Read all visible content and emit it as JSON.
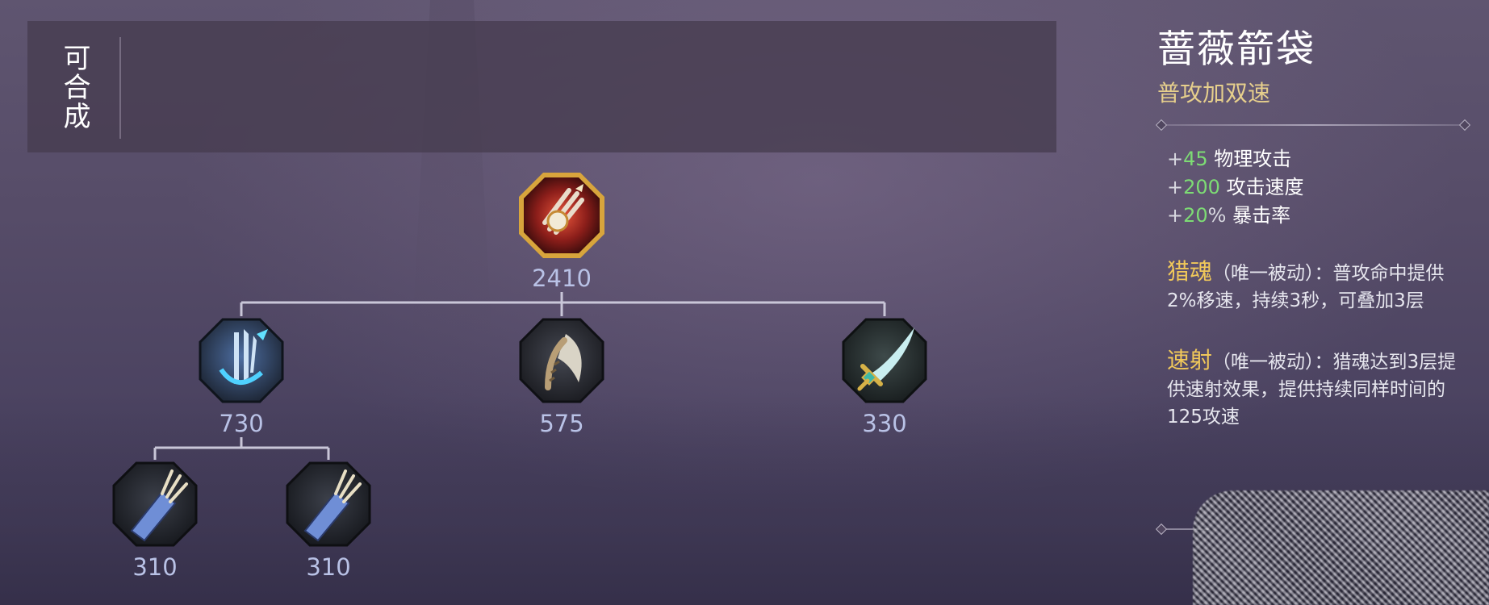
{
  "craft_panel": {
    "label": "可合成"
  },
  "tree": {
    "root": {
      "name": "蔷薇箭袋",
      "price": "2410",
      "icon": "quiver-rose-icon"
    },
    "level1": [
      {
        "price": "730",
        "icon": "arrow-crossbow-icon"
      },
      {
        "price": "575",
        "icon": "axe-icon"
      },
      {
        "price": "330",
        "icon": "dagger-icon"
      }
    ],
    "level2": [
      {
        "price": "310",
        "icon": "quiver-icon"
      },
      {
        "price": "310",
        "icon": "quiver-icon"
      }
    ]
  },
  "detail": {
    "name": "蔷薇箭袋",
    "tag": "普攻加双速",
    "stats": [
      {
        "plus": "+",
        "value": "45",
        "unit": "",
        "label": "物理攻击"
      },
      {
        "plus": "+",
        "value": "200",
        "unit": "",
        "label": "攻击速度"
      },
      {
        "plus": "+",
        "value": "20",
        "unit": "%",
        "label": "暴击率"
      }
    ],
    "passives": [
      {
        "name": "猎魂",
        "type": "（唯一被动）：",
        "text": "普攻命中提供2%移速，持续3秒，可叠加3层"
      },
      {
        "name": "速射",
        "type": "（唯一被动）：",
        "text": "猎魂达到3层提供速射效果，提供持续同样时间的125攻速"
      }
    ]
  },
  "colors": {
    "price": "#b9c2e6",
    "stat_value": "#7ddc74",
    "passive_name": "#f0c85a",
    "tag": "#e6cf8c"
  }
}
